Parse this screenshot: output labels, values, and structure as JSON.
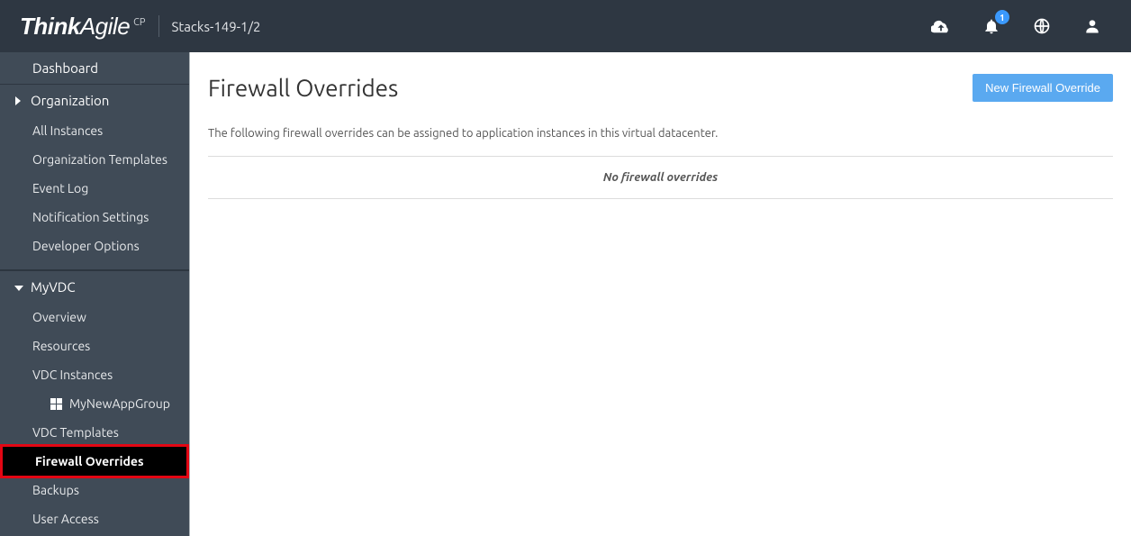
{
  "header": {
    "brand_think": "Think",
    "brand_agile": "Agile",
    "brand_cp": "CP",
    "stack": "Stacks-149-1/2",
    "notification_count": "1"
  },
  "sidebar": {
    "dashboard": "Dashboard",
    "organization": "Organization",
    "org_items": {
      "all_instances": "All Instances",
      "org_templates": "Organization Templates",
      "event_log": "Event Log",
      "notification_settings": "Notification Settings",
      "developer_options": "Developer Options"
    },
    "vdc": "MyVDC",
    "vdc_items": {
      "overview": "Overview",
      "resources": "Resources",
      "vdc_instances": "VDC Instances",
      "app_group": "MyNewAppGroup",
      "vdc_templates": "VDC Templates",
      "firewall_overrides": "Firewall Overrides",
      "backups": "Backups",
      "user_access": "User Access"
    }
  },
  "main": {
    "title": "Firewall Overrides",
    "new_btn": "New Firewall Override",
    "description": "The following firewall overrides can be assigned to application instances in this virtual datacenter.",
    "empty": "No firewall overrides"
  }
}
